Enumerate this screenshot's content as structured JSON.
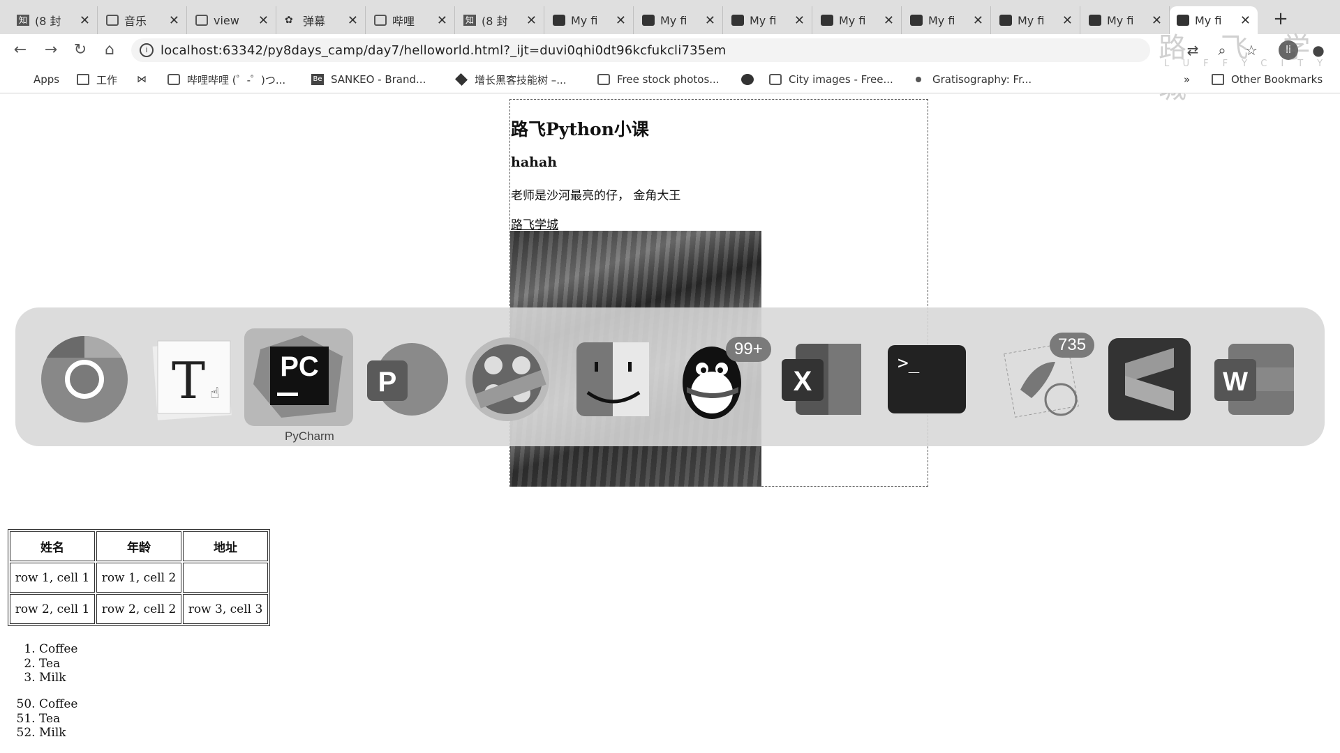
{
  "tabs": [
    {
      "title": "(8 封"
    },
    {
      "title": "音乐"
    },
    {
      "title": "view"
    },
    {
      "title": "弹幕"
    },
    {
      "title": "哔哩"
    },
    {
      "title": "(8 封"
    },
    {
      "title": "My fi"
    },
    {
      "title": "My fi"
    },
    {
      "title": "My fi"
    },
    {
      "title": "My fi"
    },
    {
      "title": "My fi"
    },
    {
      "title": "My fi"
    },
    {
      "title": "My fi"
    },
    {
      "title": "My fi"
    }
  ],
  "address_bar": {
    "url": "localhost:63342/py8days_camp/day7/helloworld.html?_ijt=duvi0qhi0dt96kcfukcli735em"
  },
  "profile_initial": "li",
  "watermark": {
    "title": "路 飞 学 城",
    "subtitle": "LUFFYCITY"
  },
  "bookmarks": {
    "apps": "Apps",
    "items": [
      "工作",
      "哔哩哔哩 (゜-゜)つ...",
      "SANKEO - Brand...",
      "增长黑客技能树 –...",
      "Free stock photos...",
      "City images - Free...",
      "Gratisography: Fr..."
    ],
    "overflow": "»",
    "other": "Other Bookmarks"
  },
  "page": {
    "heading": "路飞Python小课",
    "subheading": "hahah",
    "paragraph": "老师是沙河最亮的仔， 金角大王",
    "link": "路飞学城",
    "table": {
      "headers": [
        "姓名",
        "年龄",
        "地址"
      ],
      "rows": [
        [
          "row 1, cell 1",
          "row 1, cell 2",
          ""
        ],
        [
          "row 2, cell 1",
          "row 2, cell 2",
          "row 3, cell 3"
        ]
      ]
    },
    "list1": [
      "Coffee",
      "Tea",
      "Milk"
    ],
    "list2_start": 50,
    "list2": [
      "Coffee",
      "Tea",
      "Milk"
    ]
  },
  "dock": {
    "selected_label": "PyCharm",
    "qq_badge": "99+",
    "mail_badge": "735"
  }
}
